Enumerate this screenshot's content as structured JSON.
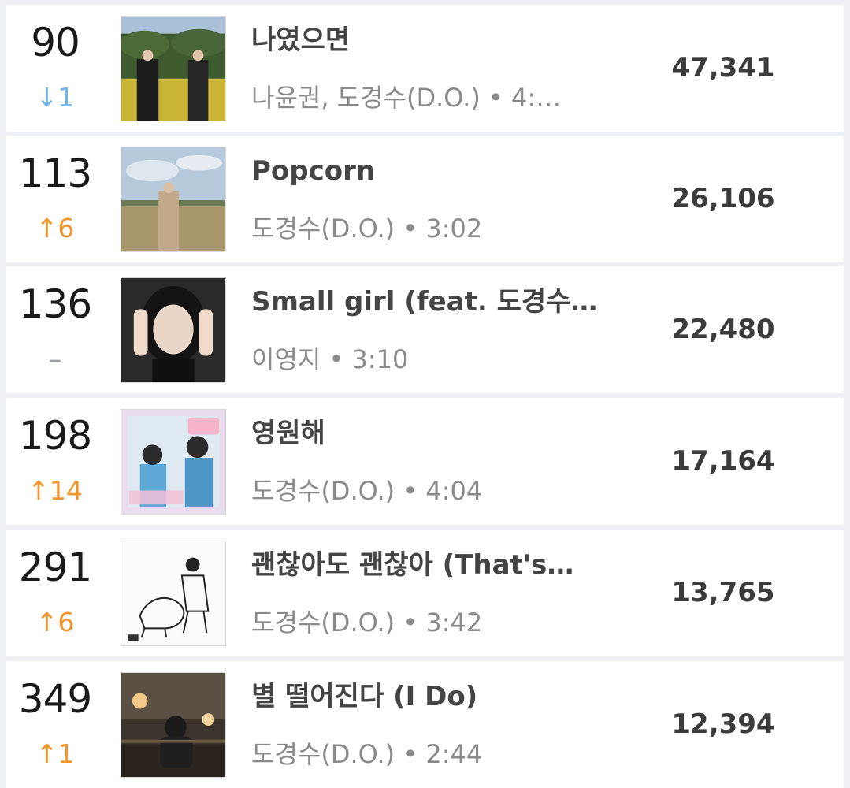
{
  "rows": [
    {
      "rank": "90",
      "change": "↓1",
      "change_dir": "down",
      "title": "나였으면",
      "meta": "나윤권, 도경수(D.O.) • 4:…",
      "plays": "47,341",
      "cover_icon": "album-cover-two-men-field"
    },
    {
      "rank": "113",
      "change": "↑6",
      "change_dir": "up",
      "title": "Popcorn",
      "meta": "도경수(D.O.) • 3:02",
      "plays": "26,106",
      "cover_icon": "album-cover-man-field"
    },
    {
      "rank": "136",
      "change": "–",
      "change_dir": "same",
      "title": "Small girl (feat. 도경수…",
      "meta": "이영지 • 3:10",
      "plays": "22,480",
      "cover_icon": "album-cover-portrait"
    },
    {
      "rank": "198",
      "change": "↑14",
      "change_dir": "up",
      "title": "영원해",
      "meta": "도경수(D.O.) • 4:04",
      "plays": "17,164",
      "cover_icon": "album-cover-drama-ost"
    },
    {
      "rank": "291",
      "change": "↑6",
      "change_dir": "up",
      "title": "괜찮아도 괜찮아 (That's…",
      "meta": "도경수(D.O.) • 3:42",
      "plays": "13,765",
      "cover_icon": "album-cover-line-drawing"
    },
    {
      "rank": "349",
      "change": "↑1",
      "change_dir": "up",
      "title": "별 떨어진다 (I Do)",
      "meta": "도경수(D.O.) • 2:44",
      "plays": "12,394",
      "cover_icon": "album-cover-dark-room"
    }
  ]
}
